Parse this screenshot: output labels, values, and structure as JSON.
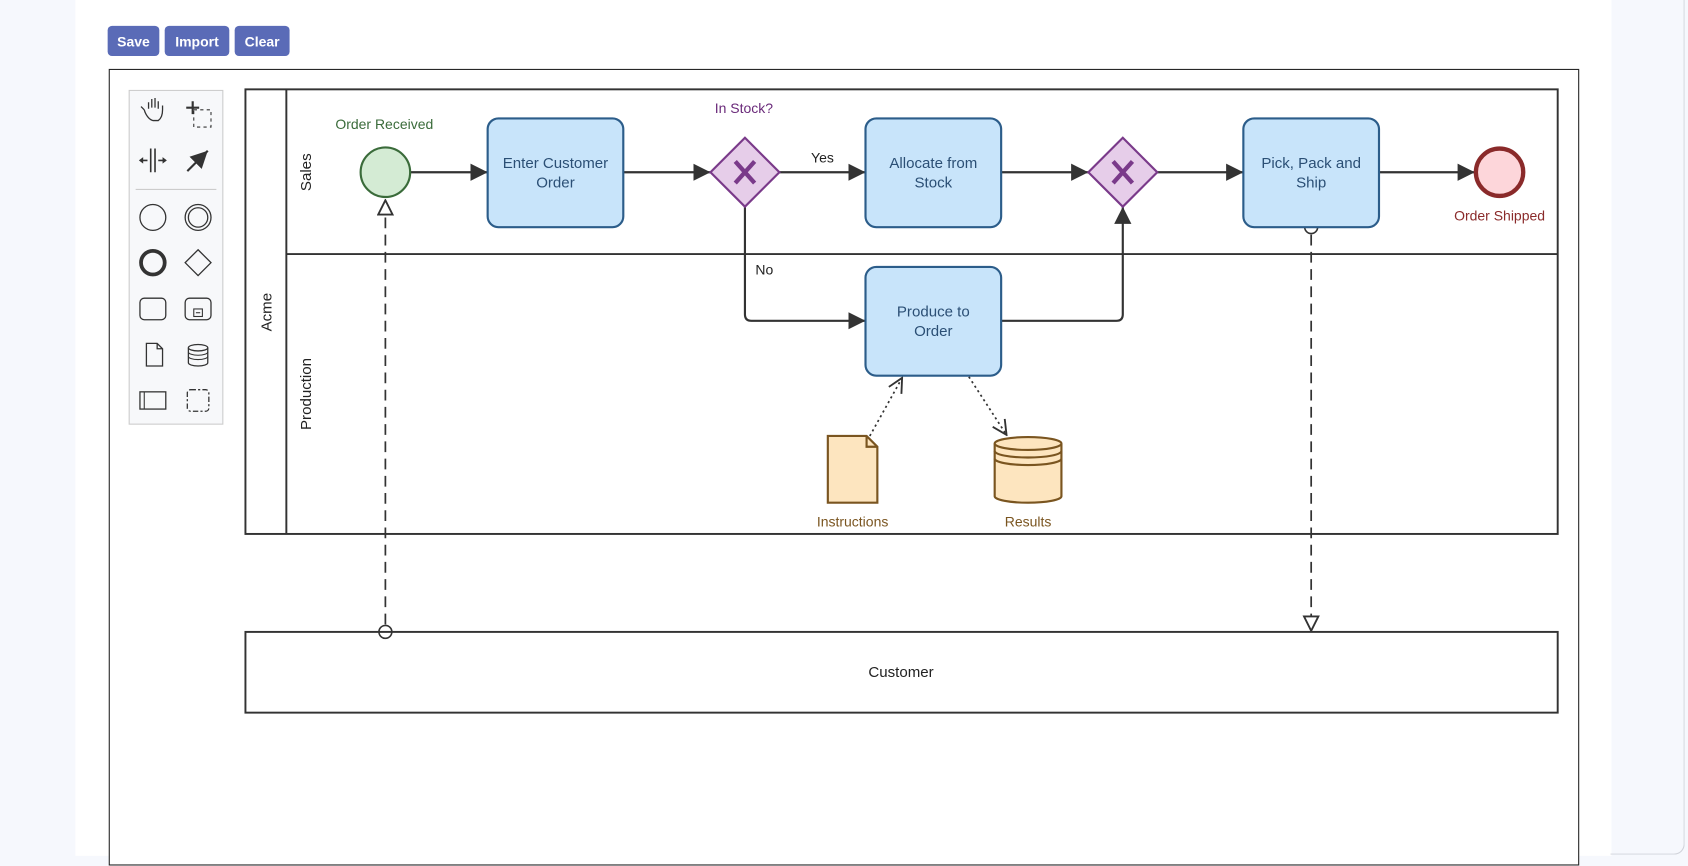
{
  "toolbar": {
    "save_label": "Save",
    "import_label": "Import",
    "clear_label": "Clear"
  },
  "palette": {
    "tools": [
      "hand-tool",
      "lasso-tool",
      "space-tool",
      "connect-tool",
      "start-event",
      "intermediate-event",
      "end-event",
      "gateway",
      "task",
      "subprocess",
      "data-object",
      "data-store",
      "participant",
      "group"
    ]
  },
  "diagram": {
    "pool": "Acme",
    "lanes": [
      "Sales",
      "Production"
    ],
    "start_event": "Order Received",
    "end_event": "Order Shipped",
    "tasks": {
      "enter": "Enter Customer|Order",
      "allocate": "Allocate from|Stock",
      "pick": "Pick, Pack and|Ship",
      "produce": "Produce to|Order"
    },
    "gateway_label": "In Stock?",
    "flow_yes": "Yes",
    "flow_no": "No",
    "data_object": "Instructions",
    "data_store": "Results",
    "customer_pool": "Customer"
  },
  "colors": {
    "button": "#5a6bb7",
    "task_fill": "#c8e4fa",
    "task_stroke": "#2c5d8a",
    "gateway_fill": "#e6cde9",
    "gateway_stroke": "#7a3a8a",
    "start_fill": "#d4ebd4",
    "start_stroke": "#3a6b3a",
    "end_fill": "#fdd6da",
    "end_stroke": "#8a2a2a",
    "data_fill": "#fde5bf",
    "data_stroke": "#7a5520"
  }
}
